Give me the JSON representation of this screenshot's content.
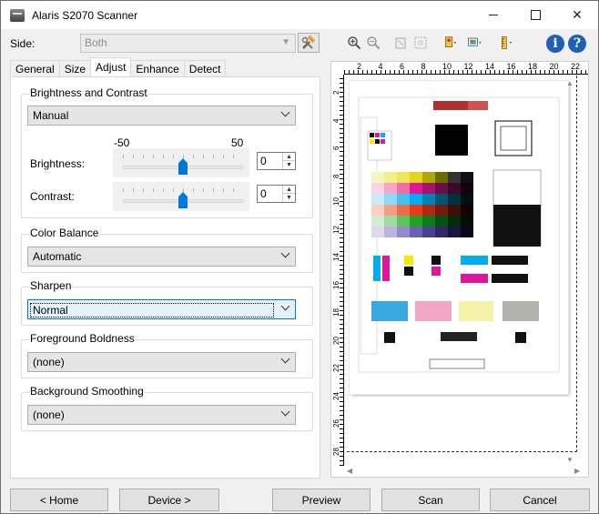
{
  "window": {
    "title": "Alaris S2070 Scanner"
  },
  "side": {
    "label": "Side:",
    "value": "Both"
  },
  "tabs": [
    {
      "label": "General"
    },
    {
      "label": "Size"
    },
    {
      "label": "Adjust"
    },
    {
      "label": "Enhance"
    },
    {
      "label": "Detect"
    }
  ],
  "brightness_contrast": {
    "title": "Brightness and Contrast",
    "mode": "Manual",
    "min_label": "-50",
    "max_label": "50",
    "brightness": {
      "label": "Brightness:",
      "value": "0",
      "level": 0.5
    },
    "contrast": {
      "label": "Contrast:",
      "value": "0",
      "level": 0.5
    }
  },
  "color_balance": {
    "title": "Color Balance",
    "value": "Automatic"
  },
  "sharpen": {
    "title": "Sharpen",
    "value": "Normal"
  },
  "foreground_boldness": {
    "title": "Foreground Boldness",
    "value": "(none)"
  },
  "background_smoothing": {
    "title": "Background Smoothing",
    "value": "(none)"
  },
  "ruler": {
    "top_labels": [
      "2",
      "4",
      "6",
      "8",
      "10",
      "12",
      "14",
      "16",
      "18",
      "20",
      "22"
    ],
    "left_labels": [
      "2",
      "4",
      "6",
      "8",
      "10",
      "12",
      "14",
      "16",
      "18",
      "20",
      "22",
      "24",
      "26",
      "28"
    ]
  },
  "preview_toolbar": {
    "icons": [
      "zoom-in-icon",
      "zoom-out-icon",
      "rotate-icon",
      "fit-icon",
      "auto-icon",
      "color-icon",
      "measure-icon"
    ],
    "info": "i",
    "help": "?"
  },
  "buttons": {
    "home": "< Home",
    "device": "Device >",
    "preview": "Preview",
    "scan": "Scan",
    "cancel": "Cancel"
  }
}
